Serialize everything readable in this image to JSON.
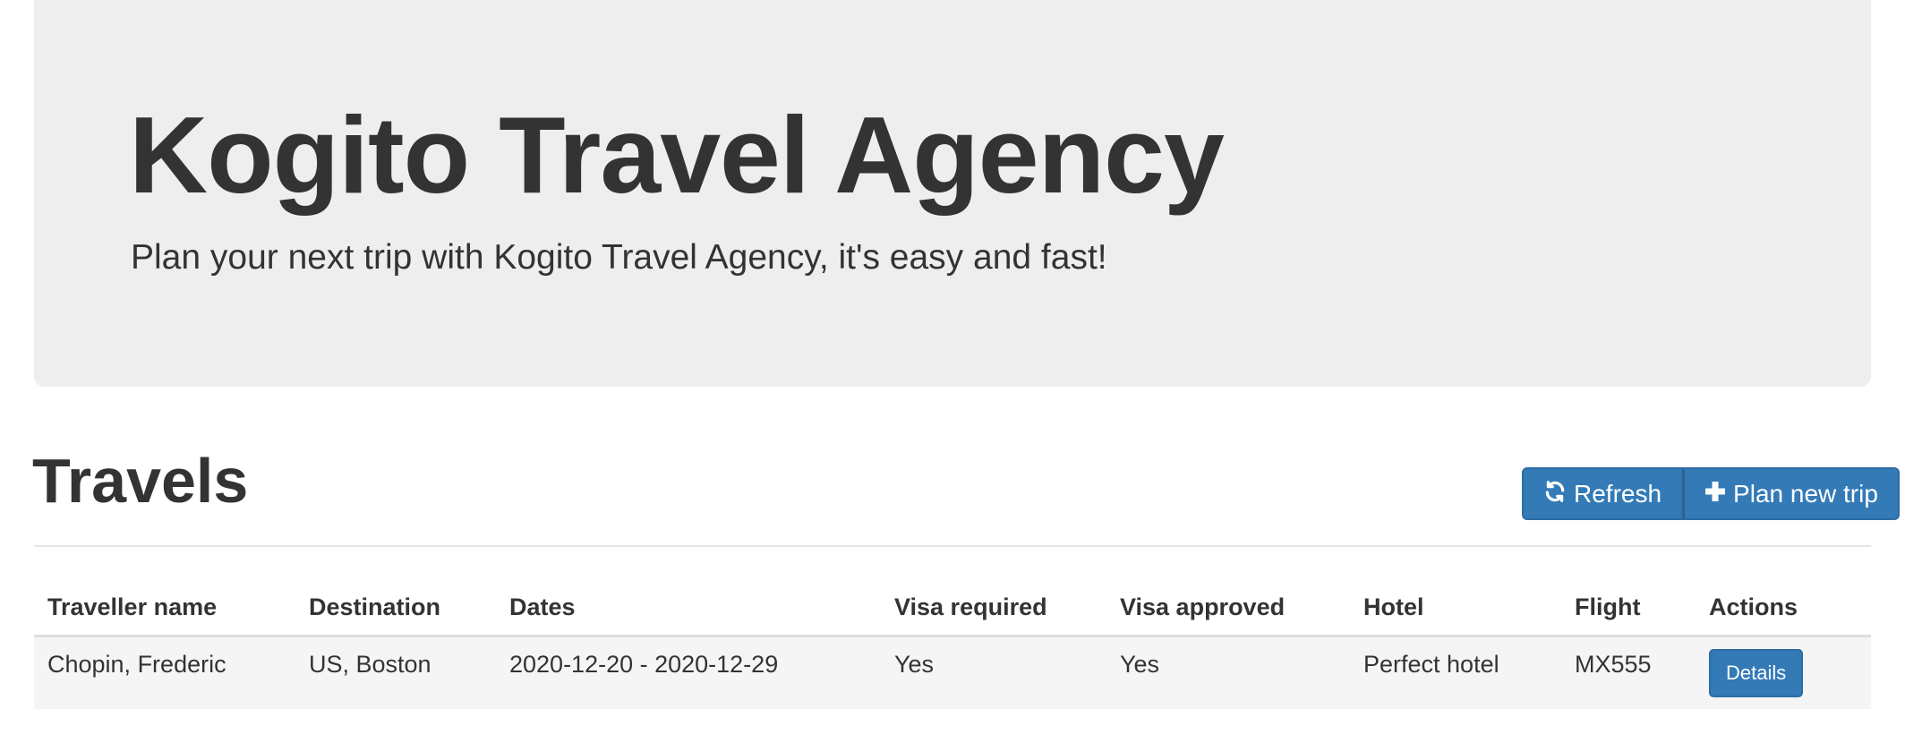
{
  "header": {
    "title": "Kogito Travel Agency",
    "subtitle": "Plan your next trip with Kogito Travel Agency, it's easy and fast!"
  },
  "travels": {
    "title": "Travels",
    "refresh_label": "Refresh",
    "refresh_icon": "refresh-icon",
    "plan_label": "Plan new trip",
    "plan_icon": "plus-icon",
    "columns": [
      "Traveller name",
      "Destination",
      "Dates",
      "Visa required",
      "Visa approved",
      "Hotel",
      "Flight",
      "Actions"
    ],
    "rows": [
      {
        "traveller": "Chopin, Frederic",
        "destination": "US, Boston",
        "dates": "2020-12-20 - 2020-12-29",
        "visa_required": "Yes",
        "visa_approved": "Yes",
        "hotel": "Perfect hotel",
        "flight": "MX555",
        "action_label": "Details"
      }
    ]
  },
  "colors": {
    "primary": "#337ab7",
    "jumbotron_bg": "#eeeeee",
    "row_bg": "#f5f5f5",
    "text": "#333333"
  }
}
